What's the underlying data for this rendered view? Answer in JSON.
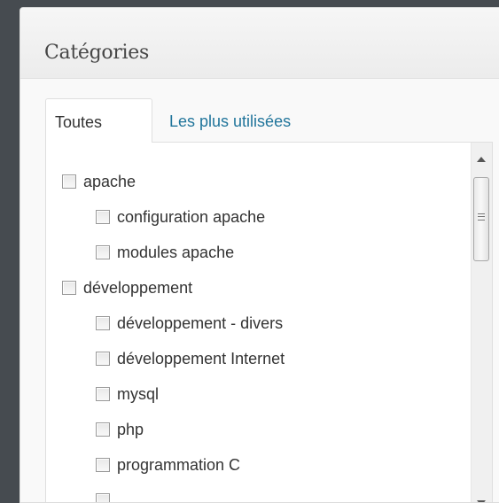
{
  "panel": {
    "title": "Catégories",
    "tabs": [
      {
        "label": "Toutes",
        "active": true
      },
      {
        "label": "Les plus utilisées",
        "active": false
      }
    ]
  },
  "categories": [
    {
      "label": "apache",
      "level": 0,
      "checked": false
    },
    {
      "label": "configuration apache",
      "level": 1,
      "checked": false
    },
    {
      "label": "modules apache",
      "level": 1,
      "checked": false
    },
    {
      "label": "développement",
      "level": 0,
      "checked": false
    },
    {
      "label": "développement - divers",
      "level": 1,
      "checked": false
    },
    {
      "label": "développement Internet",
      "level": 1,
      "checked": false
    },
    {
      "label": "mysql",
      "level": 1,
      "checked": false
    },
    {
      "label": "php",
      "level": 1,
      "checked": false
    },
    {
      "label": "programmation C",
      "level": 1,
      "checked": false
    }
  ],
  "colors": {
    "link": "#21759b",
    "text": "#333333",
    "background": "#464b50"
  }
}
